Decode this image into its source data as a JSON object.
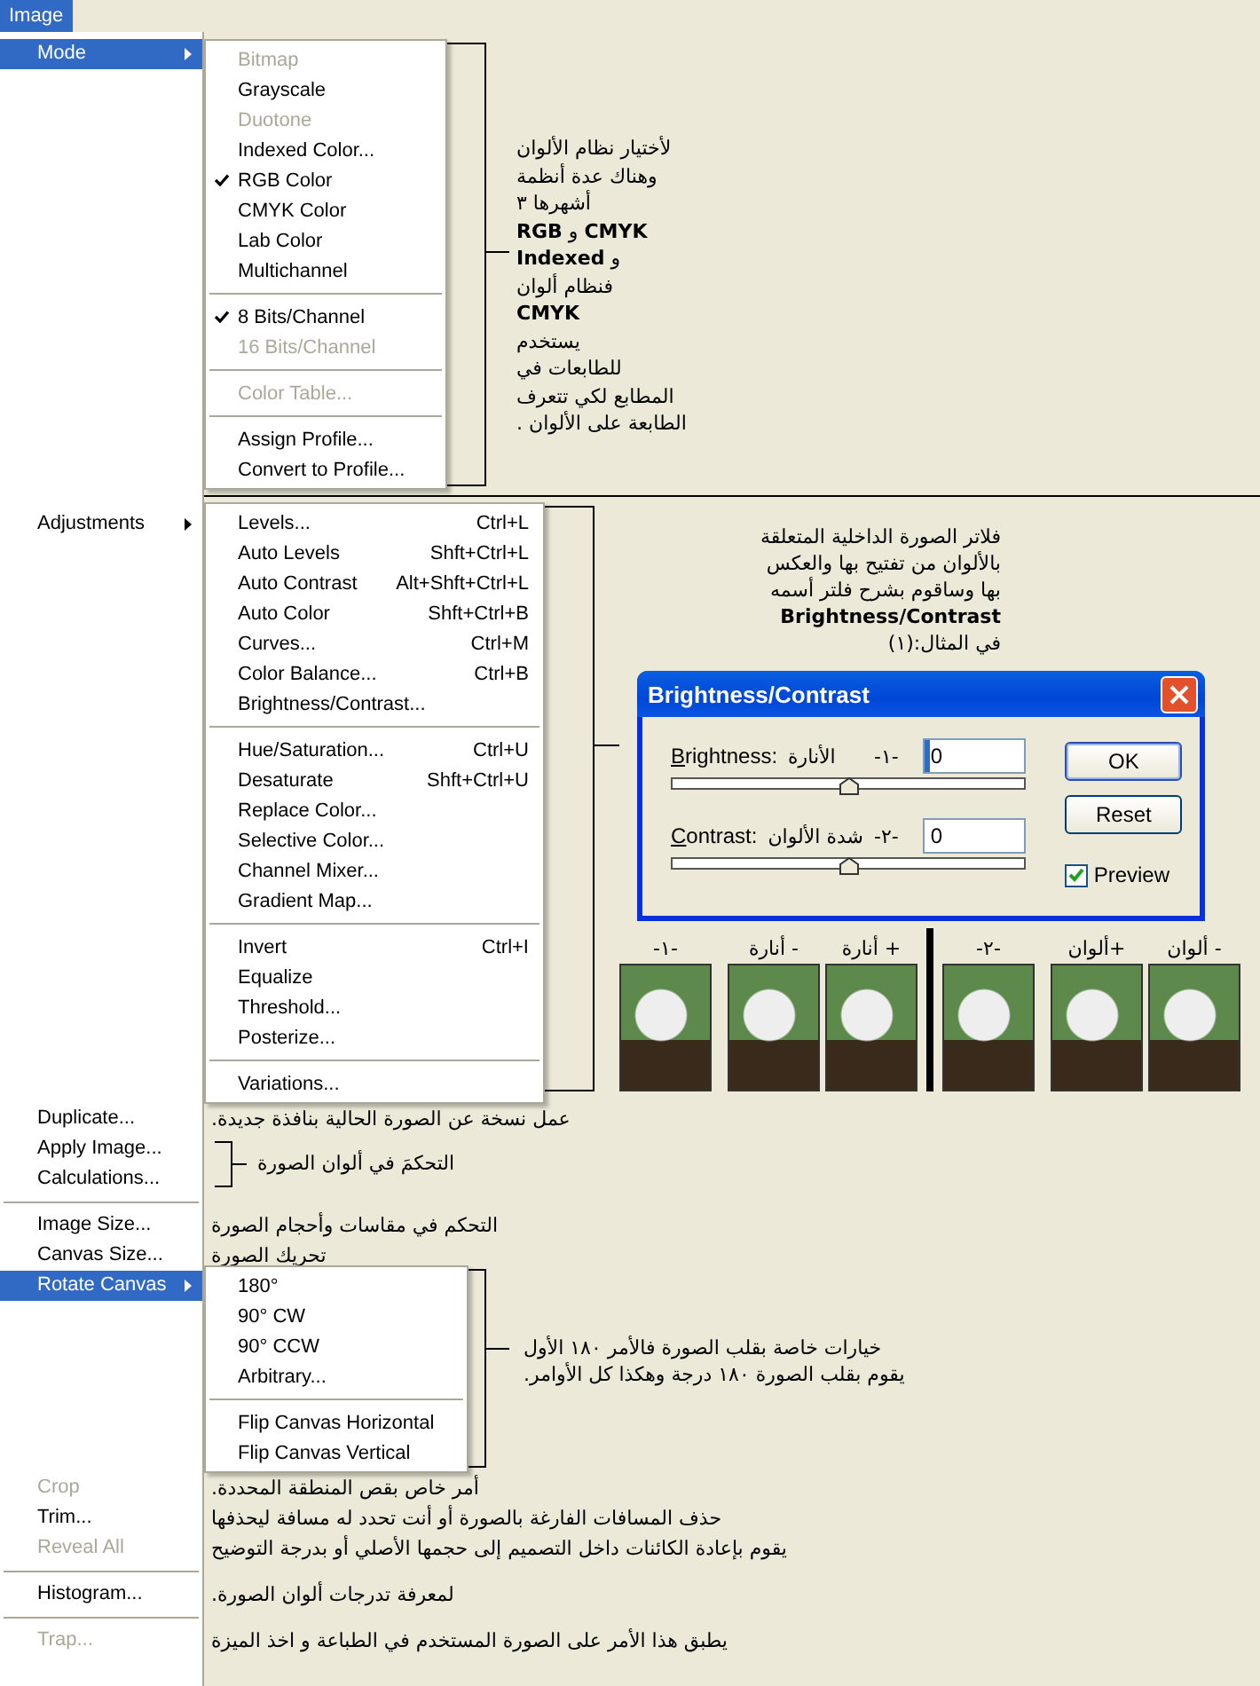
{
  "menu_bar": {
    "title": "Image",
    "selected": true
  },
  "menu": {
    "items": [
      {
        "kind": "item",
        "label": "Mode",
        "selected": true,
        "disabled": false,
        "submenu": {
          "items": [
            {
              "kind": "item",
              "label": "Bitmap",
              "checked": false,
              "disabled": true
            },
            {
              "kind": "item",
              "label": "Grayscale",
              "checked": false,
              "disabled": false
            },
            {
              "kind": "item",
              "label": "Duotone",
              "checked": false,
              "disabled": true
            },
            {
              "kind": "item",
              "label": "Indexed Color...",
              "checked": false,
              "disabled": false
            },
            {
              "kind": "item",
              "label": "RGB Color",
              "checked": true,
              "disabled": false
            },
            {
              "kind": "item",
              "label": "CMYK Color",
              "checked": false,
              "disabled": false
            },
            {
              "kind": "item",
              "label": "Lab Color",
              "checked": false,
              "disabled": false
            },
            {
              "kind": "item",
              "label": "Multichannel",
              "checked": false,
              "disabled": false
            },
            {
              "kind": "separator"
            },
            {
              "kind": "item",
              "label": "8 Bits/Channel",
              "checked": true,
              "disabled": false
            },
            {
              "kind": "item",
              "label": "16 Bits/Channel",
              "checked": false,
              "disabled": true
            },
            {
              "kind": "separator"
            },
            {
              "kind": "item",
              "label": "Color Table...",
              "checked": false,
              "disabled": true
            },
            {
              "kind": "separator"
            },
            {
              "kind": "item",
              "label": "Assign Profile...",
              "checked": false,
              "disabled": false
            },
            {
              "kind": "item",
              "label": "Convert to Profile...",
              "checked": false,
              "disabled": false
            }
          ]
        },
        "note": {
          "kind": "side",
          "text": "لأختيار نظام الألوان\nوهناك عدة أنظمة\nأشهرها ٣\n**CMYK** و **RGB**\nو **Indexed**\nفنظام ألوان\n**CMYK**\nيستخدم\nللطابعات في\nالمطابع لكي تتعرف\nالطابعة على الألوان ."
        }
      },
      {
        "kind": "divider"
      },
      {
        "kind": "item",
        "label": "Adjustments",
        "selected": false,
        "disabled": false,
        "submenu": {
          "items": [
            {
              "kind": "item",
              "label": "Levels...",
              "shortcut": "Ctrl+L",
              "checked": false,
              "disabled": false
            },
            {
              "kind": "item",
              "label": "Auto Levels",
              "shortcut": "Shft+Ctrl+L",
              "checked": false,
              "disabled": false
            },
            {
              "kind": "item",
              "label": "Auto Contrast",
              "shortcut": "Alt+Shft+Ctrl+L",
              "checked": false,
              "disabled": false
            },
            {
              "kind": "item",
              "label": "Auto Color",
              "shortcut": "Shft+Ctrl+B",
              "checked": false,
              "disabled": false
            },
            {
              "kind": "item",
              "label": "Curves...",
              "shortcut": "Ctrl+M",
              "checked": false,
              "disabled": false
            },
            {
              "kind": "item",
              "label": "Color Balance...",
              "shortcut": "Ctrl+B",
              "checked": false,
              "disabled": false
            },
            {
              "kind": "item",
              "label": "Brightness/Contrast...",
              "checked": false,
              "disabled": false
            },
            {
              "kind": "separator"
            },
            {
              "kind": "item",
              "label": "Hue/Saturation...",
              "shortcut": "Ctrl+U",
              "checked": false,
              "disabled": false
            },
            {
              "kind": "item",
              "label": "Desaturate",
              "shortcut": "Shft+Ctrl+U",
              "checked": false,
              "disabled": false
            },
            {
              "kind": "item",
              "label": "Replace Color...",
              "checked": false,
              "disabled": false
            },
            {
              "kind": "item",
              "label": "Selective Color...",
              "checked": false,
              "disabled": false
            },
            {
              "kind": "item",
              "label": "Channel Mixer...",
              "checked": false,
              "disabled": false
            },
            {
              "kind": "item",
              "label": "Gradient Map...",
              "checked": false,
              "disabled": false
            },
            {
              "kind": "separator"
            },
            {
              "kind": "item",
              "label": "Invert",
              "shortcut": "Ctrl+I",
              "checked": false,
              "disabled": false
            },
            {
              "kind": "item",
              "label": "Equalize",
              "checked": false,
              "disabled": false
            },
            {
              "kind": "item",
              "label": "Threshold...",
              "checked": false,
              "disabled": false
            },
            {
              "kind": "item",
              "label": "Posterize...",
              "checked": false,
              "disabled": false
            },
            {
              "kind": "separator"
            },
            {
              "kind": "item",
              "label": "Variations...",
              "checked": false,
              "disabled": false
            }
          ]
        },
        "note": {
          "kind": "side",
          "text": "فلاتر الصورة الداخلية المتعلقة\nبالألوان من تفتيح بها والعكس\nبها وساقوم بشرح فلتر أسمه\n**Brightness/Contrast**\nفي المثال:(١)"
        },
        "dialog": {
          "title": "Brightness/Contrast",
          "fields": [
            {
              "label": "Brightness:",
              "label_ar": "الأنارة",
              "tag": "-١-",
              "value": "0",
              "focused": true,
              "level": 0.5
            },
            {
              "label": "Contrast:",
              "label_ar": "شدة الألوان",
              "tag": "-٢-",
              "value": "0",
              "focused": false,
              "level": 0.5
            }
          ],
          "buttons": [
            {
              "label": "OK",
              "default": true
            },
            {
              "label": "Reset",
              "default": false
            }
          ],
          "preview": {
            "label": "Preview",
            "checked": true
          }
        },
        "examples": [
          {
            "photos": [
              {
                "caption": "- ألوان"
              },
              {
                "caption": "+ألوان"
              },
              {
                "caption": "-٢-"
              }
            ]
          },
          {
            "photos": [
              {
                "caption": "+ أنارة"
              },
              {
                "caption": "- أنارة"
              },
              {
                "caption": "-١-"
              }
            ]
          }
        ]
      },
      {
        "kind": "item",
        "label": "Duplicate...",
        "selected": false,
        "disabled": false,
        "note": {
          "kind": "plain",
          "text": "عمل نسخة عن الصورة الحالية بنافذة جديدة."
        }
      },
      {
        "kind": "item",
        "label": "Apply Image...",
        "selected": false,
        "disabled": false,
        "note": {
          "kind": "bracket",
          "text": "التحكمَ في ألوان الصورة"
        }
      },
      {
        "kind": "item",
        "label": "Calculations...",
        "selected": false,
        "disabled": false
      },
      {
        "kind": "separator"
      },
      {
        "kind": "item",
        "label": "Image Size...",
        "selected": false,
        "disabled": false,
        "note": {
          "kind": "plain",
          "text": "التحكم في مقاسات وأحجام الصورة"
        }
      },
      {
        "kind": "item",
        "label": "Canvas Size...",
        "selected": false,
        "disabled": false,
        "note": {
          "kind": "plain",
          "text": "تحريك الصورة"
        }
      },
      {
        "kind": "item",
        "label": "Rotate Canvas",
        "selected": true,
        "disabled": false,
        "submenu": {
          "items": [
            {
              "kind": "item",
              "label": "180°",
              "checked": false,
              "disabled": false
            },
            {
              "kind": "item",
              "label": "90° CW",
              "checked": false,
              "disabled": false
            },
            {
              "kind": "item",
              "label": "90° CCW",
              "checked": false,
              "disabled": false
            },
            {
              "kind": "item",
              "label": "Arbitrary...",
              "checked": false,
              "disabled": false
            },
            {
              "kind": "separator"
            },
            {
              "kind": "item",
              "label": "Flip Canvas Horizontal",
              "checked": false,
              "disabled": false
            },
            {
              "kind": "item",
              "label": "Flip Canvas Vertical",
              "checked": false,
              "disabled": false
            }
          ]
        },
        "note": {
          "kind": "side",
          "text": "خيارات خاصة بقلب الصورة فالأمر ١٨٠ الأول\nيقوم بقلب الصورة ١٨٠ درجة وهكذا كل الأوامر."
        }
      },
      {
        "kind": "item",
        "label": "Crop",
        "selected": false,
        "disabled": true,
        "note": {
          "kind": "plain",
          "text": "أمر خاص بقص المنطقة المحددة."
        }
      },
      {
        "kind": "item",
        "label": "Trim...",
        "selected": false,
        "disabled": false,
        "note": {
          "kind": "plain",
          "text": "حذف المسافات الفارغة بالصورة أو أنت تحدد له مسافة ليحذفها"
        }
      },
      {
        "kind": "item",
        "label": "Reveal All",
        "selected": false,
        "disabled": true,
        "note": {
          "kind": "plain",
          "text": "يقوم بإعادة الكائنات داخل التصميم إلى حجمها الأصلي أو بدرجة التوضيح"
        }
      },
      {
        "kind": "separator"
      },
      {
        "kind": "item",
        "label": "Histogram...",
        "selected": false,
        "disabled": false,
        "note": {
          "kind": "plain",
          "text": "لمعرفة تدرجات ألوان الصورة."
        }
      },
      {
        "kind": "separator"
      },
      {
        "kind": "item",
        "label": "Trap...",
        "selected": false,
        "disabled": true,
        "note": {
          "kind": "plain",
          "text": "يطبق هذا الأمر على الصورة المستخدم في الطباعة و اخذ الميزة"
        }
      }
    ]
  }
}
